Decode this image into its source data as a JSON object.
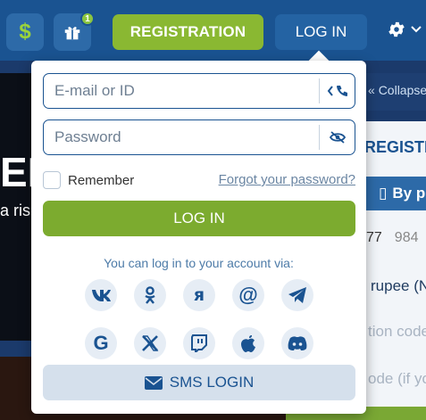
{
  "header": {
    "gift_badge": "1",
    "registration_label": "REGISTRATION",
    "login_label": "LOG IN"
  },
  "background": {
    "hero_big_letters": "ER",
    "hero_sub": "a ris",
    "collapse": "Collapse b",
    "registration_partial": "REGISTR",
    "by_phone": "By p",
    "phone_code": "77",
    "phone_prefix": "984",
    "currency": "rupee (N",
    "promo_code": "tion code",
    "code_if": "ode (if you"
  },
  "login_form": {
    "email_placeholder": "E-mail or ID",
    "password_placeholder": "Password",
    "remember_label": "Remember",
    "forgot_password": "Forgot your password?",
    "login_button": "LOG IN",
    "social_heading": "You can log in to your account via:",
    "social_icons": [
      "vk-icon",
      "odnoklassniki-icon",
      "yandex-icon",
      "mailru-icon",
      "telegram-icon",
      "google-icon",
      "x-icon",
      "twitch-icon",
      "apple-icon",
      "discord-icon"
    ],
    "sms_login": "SMS LOGIN"
  },
  "colors": {
    "header_bg": "#1a5391",
    "primary_green": "#7cab2f",
    "link_blue": "#1a5391",
    "social_bg": "#e6edf5"
  }
}
